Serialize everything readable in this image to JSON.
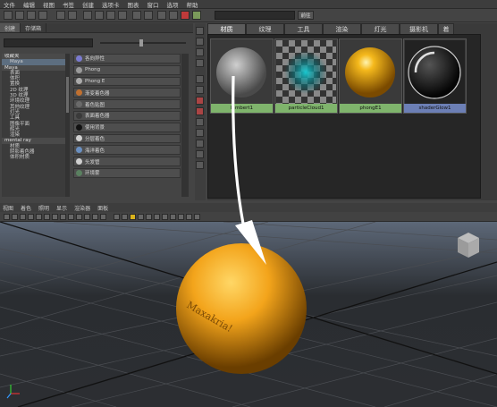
{
  "menubar": [
    "文件",
    "编辑",
    "视图",
    "书签",
    "创建",
    "选项卡",
    "图表",
    "窗口",
    "选项",
    "帮助"
  ],
  "toolbar": {
    "go_label": "前往"
  },
  "left_panel": {
    "tabs": [
      "创建",
      "存储箱"
    ],
    "tree": [
      {
        "label": "收藏夹",
        "type": "cat"
      },
      {
        "label": "Maya",
        "type": "sel"
      },
      {
        "label": "Maya",
        "type": "cat"
      },
      {
        "label": "表面",
        "type": "item"
      },
      {
        "label": "体积",
        "type": "item"
      },
      {
        "label": "置换",
        "type": "item"
      },
      {
        "label": "2D 纹理",
        "type": "item"
      },
      {
        "label": "3D 纹理",
        "type": "item"
      },
      {
        "label": "环境纹理",
        "type": "item"
      },
      {
        "label": "其他纹理",
        "type": "item"
      },
      {
        "label": "灯光",
        "type": "item"
      },
      {
        "label": "工具",
        "type": "item"
      },
      {
        "label": "图像平面",
        "type": "item"
      },
      {
        "label": "辉光",
        "type": "item"
      },
      {
        "label": "渲染",
        "type": "item"
      },
      {
        "label": "mental ray",
        "type": "cat"
      },
      {
        "label": "材质",
        "type": "item"
      },
      {
        "label": "阴影着色器",
        "type": "item"
      },
      {
        "label": "体积材质",
        "type": "item"
      }
    ],
    "nodes": [
      {
        "label": "各向异性",
        "color": "#7a7ad0"
      },
      {
        "label": "Phong",
        "color": "#9a9a9a"
      },
      {
        "label": "Phong E",
        "color": "#aaaaaa"
      },
      {
        "label": "渐变着色器",
        "color": "#c07030"
      },
      {
        "label": "着色贴图",
        "color": "#6a6a6a"
      },
      {
        "label": "表面着色器",
        "color": "#3a3a3a"
      },
      {
        "label": "使用背景",
        "color": "#111111"
      },
      {
        "label": "分层着色",
        "color": "#d0d0d0"
      },
      {
        "label": "海洋着色",
        "color": "#6a8fc0"
      },
      {
        "label": "头发管",
        "color": "#cfcfcf"
      },
      {
        "label": "环境雾",
        "color": "#5a8060"
      }
    ]
  },
  "hypershade": {
    "tabs": [
      "材质",
      "纹理",
      "工具",
      "渲染",
      "灯光",
      "摄影机",
      "着"
    ],
    "swatches": [
      {
        "name": "lambert1",
        "style": "gray",
        "selected": false
      },
      {
        "name": "particleCloud1",
        "style": "checker",
        "selected": false
      },
      {
        "name": "phongE1",
        "style": "gold",
        "selected": false
      },
      {
        "name": "shaderGlow1",
        "style": "dark",
        "selected": true
      }
    ]
  },
  "viewport": {
    "menu": [
      "视图",
      "着色",
      "照明",
      "显示",
      "渲染器",
      "面板"
    ],
    "sphere_text": "Maxakria!",
    "sphere_color": "#f3a41b"
  }
}
